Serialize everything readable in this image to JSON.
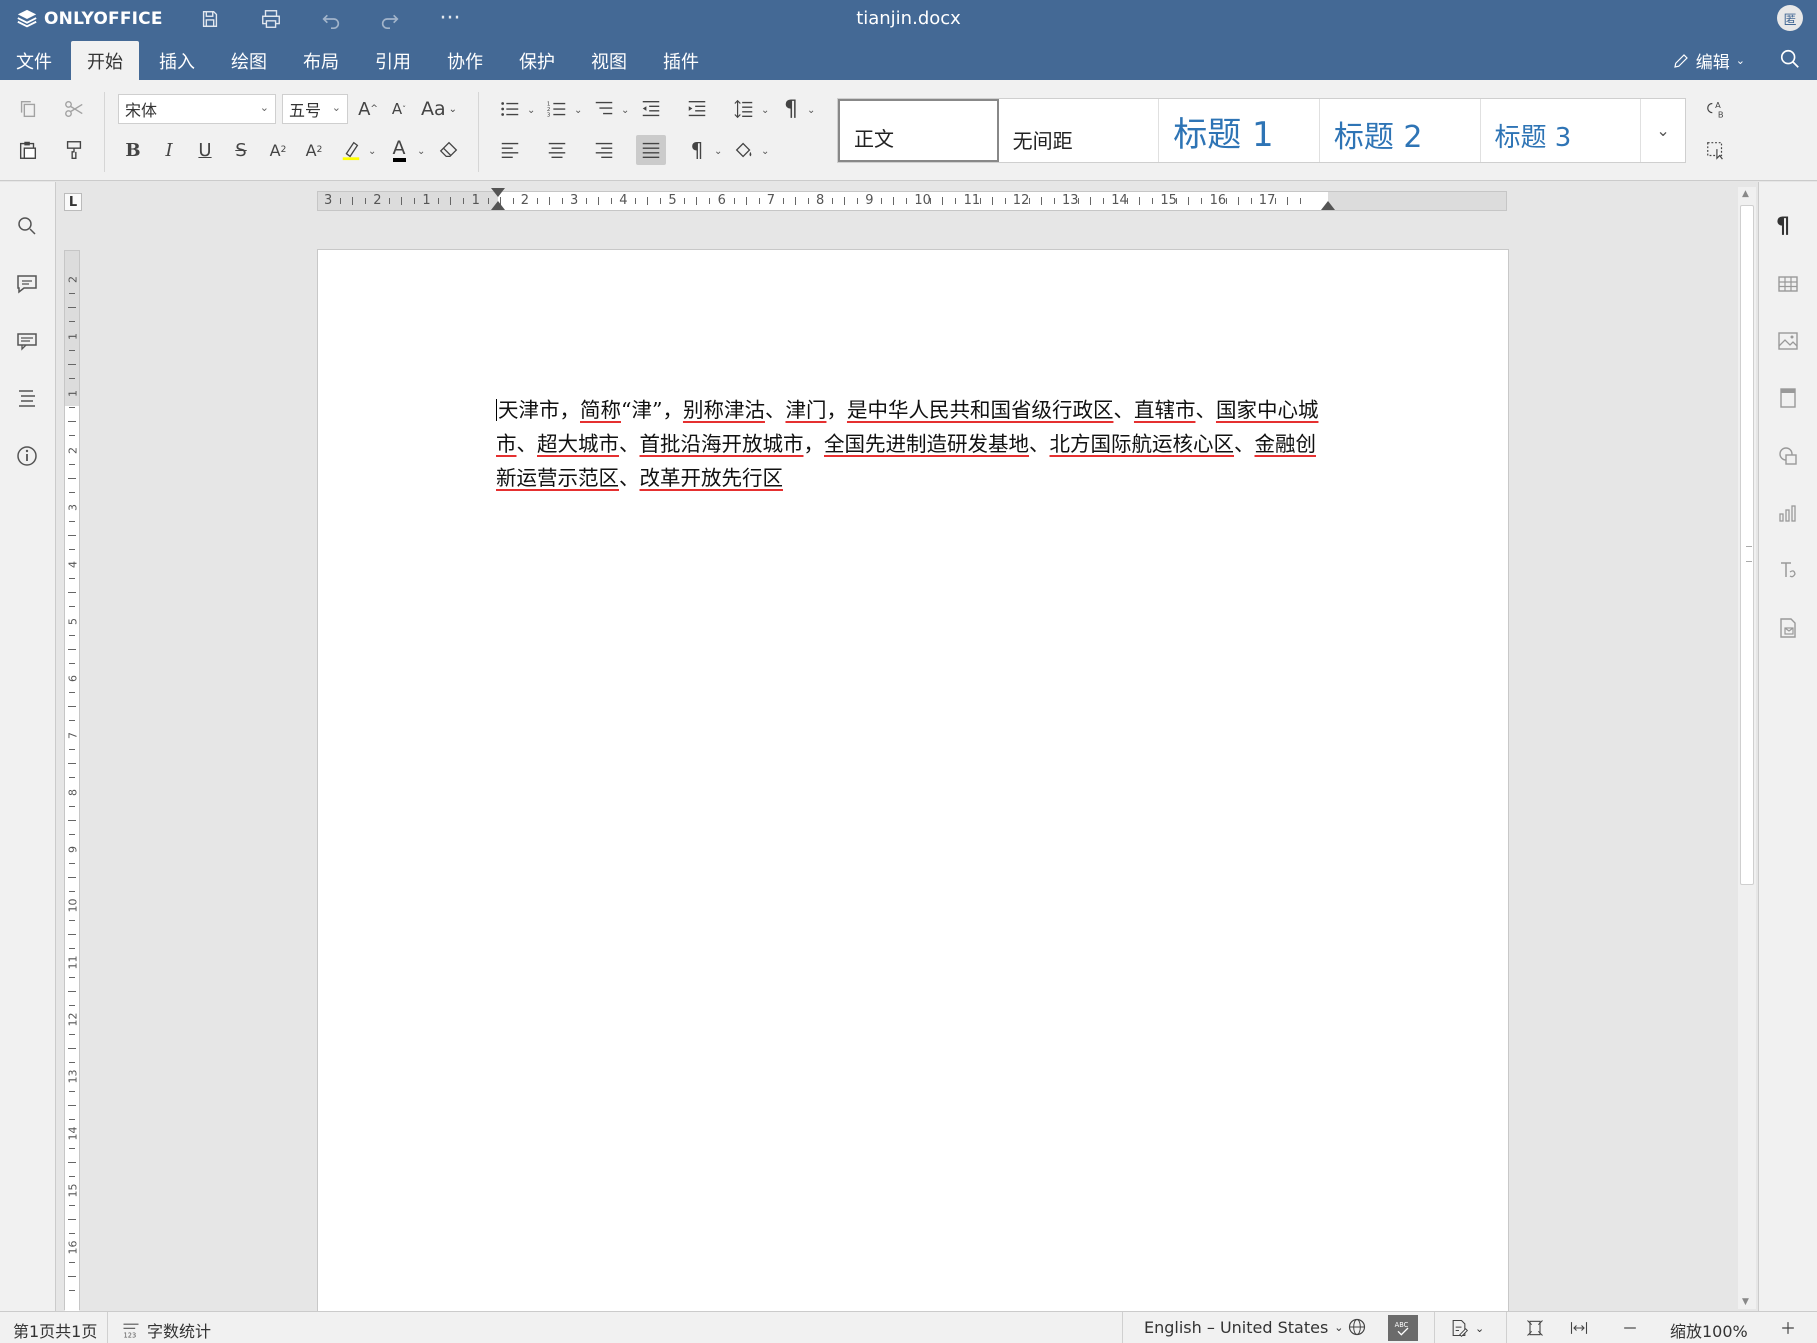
{
  "app": {
    "brand": "ONLYOFFICE",
    "document_title": "tianjin.docx",
    "avatar_initial": "匿"
  },
  "menu": {
    "tabs": [
      {
        "label": "文件"
      },
      {
        "label": "开始"
      },
      {
        "label": "插入"
      },
      {
        "label": "绘图"
      },
      {
        "label": "布局"
      },
      {
        "label": "引用"
      },
      {
        "label": "协作"
      },
      {
        "label": "保护"
      },
      {
        "label": "视图"
      },
      {
        "label": "插件"
      }
    ],
    "active_tab": "开始",
    "edit_mode_label": "编辑"
  },
  "toolbar": {
    "font_name": "宋体",
    "font_size": "五号",
    "styles": [
      {
        "label": "正文"
      },
      {
        "label": "无间距"
      },
      {
        "label": "标题 1"
      },
      {
        "label": "标题 2"
      },
      {
        "label": "标题 3"
      }
    ],
    "selected_style": "正文",
    "accent_color": "#2e74b5",
    "highlight_color": "#ffff00",
    "font_color": "#000000"
  },
  "ruler": {
    "horizontal_labels": [
      "3",
      "2",
      "1",
      "1",
      "2",
      "3",
      "4",
      "5",
      "6",
      "7",
      "8",
      "9",
      "10",
      "11",
      "12",
      "13",
      "14",
      "15",
      "16",
      "17"
    ],
    "vertical_labels": [
      "2",
      "1",
      "1",
      "2",
      "3",
      "4",
      "5",
      "6",
      "7",
      "8",
      "9",
      "10",
      "11",
      "12",
      "13",
      "14",
      "15",
      "16"
    ],
    "corner": "L"
  },
  "document": {
    "segments": [
      {
        "text": "天津市",
        "underline": false
      },
      {
        "text": "，",
        "underline": false
      },
      {
        "text": "简称",
        "underline": true
      },
      {
        "text": "“津”，",
        "underline": false
      },
      {
        "text": "别称津沽",
        "underline": true
      },
      {
        "text": "、",
        "underline": false
      },
      {
        "text": "津门",
        "underline": true
      },
      {
        "text": "，",
        "underline": false
      },
      {
        "text": "是中华人民共和国省级行政区",
        "underline": true
      },
      {
        "text": "、",
        "underline": false
      },
      {
        "text": "直辖市",
        "underline": true
      },
      {
        "text": "、",
        "underline": false
      },
      {
        "text": "国家中心城市",
        "underline": true
      },
      {
        "text": "、",
        "underline": false
      },
      {
        "text": "超大城市",
        "underline": true
      },
      {
        "text": "、",
        "underline": false
      },
      {
        "text": "首批沿海开放城市",
        "underline": true
      },
      {
        "text": "，",
        "underline": false
      },
      {
        "text": "全国先进制造研发基地",
        "underline": true
      },
      {
        "text": "、",
        "underline": false
      },
      {
        "text": "北方国际航运核心区",
        "underline": true
      },
      {
        "text": "、",
        "underline": false
      },
      {
        "text": "金融创新运营示范区",
        "underline": true
      },
      {
        "text": "、",
        "underline": false
      },
      {
        "text": "改革开放先行区",
        "underline": true
      }
    ],
    "spellcheck_color": "#e53030"
  },
  "statusbar": {
    "page_info": "第1页共1页",
    "word_count": "字数统计",
    "language": "English – United States",
    "zoom": "缩放100%"
  },
  "colors": {
    "header_bg": "#446995",
    "toolbar_bg": "#f1f1f1",
    "workspace_bg": "#e6e6e6"
  }
}
